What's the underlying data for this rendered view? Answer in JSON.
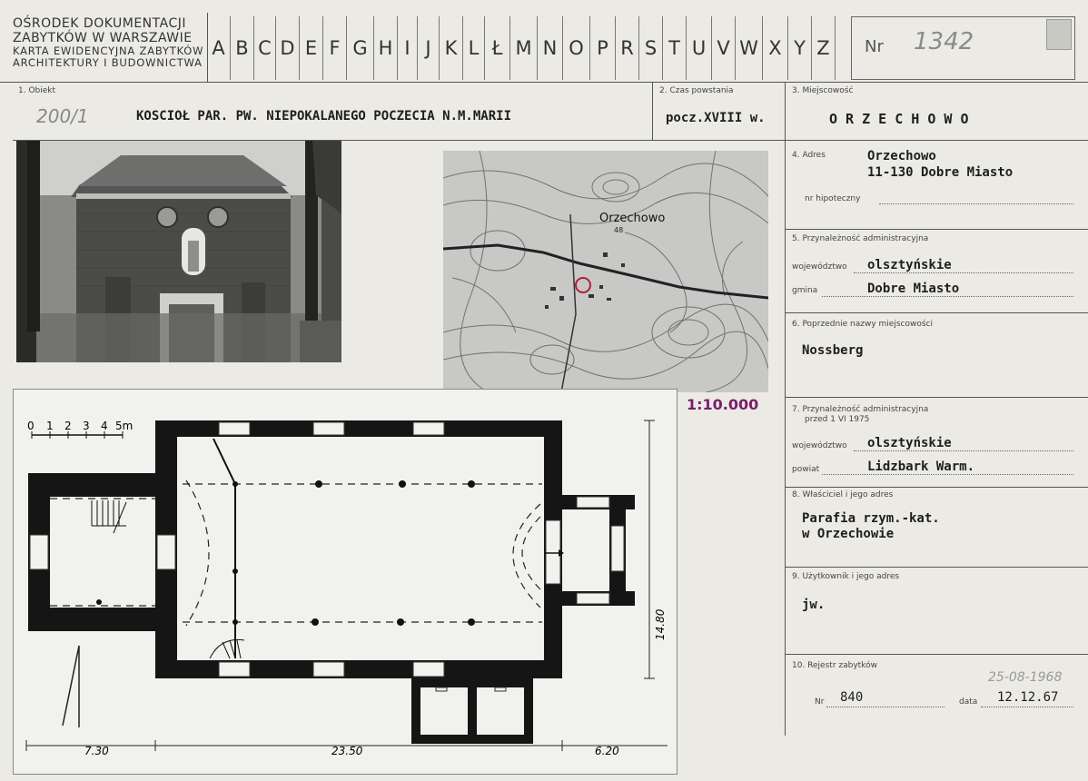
{
  "header": {
    "institution_line1": "OŚRODEK DOKUMENTACJI",
    "institution_line2": "ZABYTKÓW W WARSZAWIE",
    "institution_line3": "KARTA EWIDENCYJNA ZABYTKÓW",
    "institution_line4": "ARCHITEKTURY I BUDOWNICTWA",
    "letters": [
      "A",
      "B",
      "C",
      "D",
      "E",
      "F",
      "G",
      "H",
      "I",
      "J",
      "K",
      "L",
      "Ł",
      "M",
      "N",
      "O",
      "P",
      "R",
      "S",
      "T",
      "U",
      "V",
      "W",
      "X",
      "Y",
      "Z"
    ],
    "nr_label": "Nr",
    "nr_value": "1342"
  },
  "obiekt": {
    "label": "1. Obiekt",
    "handwritten": "200/1",
    "value": "KOSCIOŁ PAR. PW. NIEPOKALANEGO POCZECIA N.M.MARII"
  },
  "czas": {
    "label": "2. Czas powstania",
    "value": "pocz.XVIII w."
  },
  "miejscowosc": {
    "label": "3. Miejscowość",
    "value": "O R Z E C H O W O"
  },
  "adres": {
    "label": "4. Adres",
    "line1": "Orzechowo",
    "line2": "11-130 Dobre Miasto",
    "hipoteczny_label": "nr hipoteczny"
  },
  "przynaleznosc": {
    "label": "5. Przynależność administracyjna",
    "wojewodztwo_label": "województwo",
    "wojewodztwo": "olsztyńskie",
    "gmina_label": "gmina",
    "gmina": "Dobre Miasto"
  },
  "poprzednie": {
    "label": "6. Poprzednie nazwy miejscowości",
    "value": "Nossberg"
  },
  "przynaleznosc_1975": {
    "label_line1": "7. Przynależność administracyjna",
    "label_line2": "przed 1 VI 1975",
    "wojewodztwo_label": "województwo",
    "wojewodztwo": "olsztyńskie",
    "powiat_label": "powiat",
    "powiat": "Lidzbark Warm."
  },
  "wlasciciel": {
    "label": "8. Właściciel i jego adres",
    "line1": "Parafia rzym.-kat.",
    "line2": "w Orzechowie"
  },
  "uzytkownik": {
    "label": "9. Użytkownik i jego adres",
    "value": "jw."
  },
  "rejestr": {
    "label": "10. Rejestr zabytków",
    "handwritten_date": "25-08-1968",
    "nr_label": "Nr",
    "nr_value": "840",
    "data_label": "data",
    "data_value": "12.12.67"
  },
  "map": {
    "place_label": "Orzechowo",
    "scale": "1:10.000"
  },
  "plan": {
    "scale_ticks": [
      "0",
      "1",
      "2",
      "3",
      "4",
      "5m"
    ],
    "dim_bottom_left": "7.30",
    "dim_bottom_mid": "23.50",
    "dim_bottom_right": "6.20",
    "dim_right": "14.80"
  },
  "colors": {
    "paper": "#ebeae4",
    "ink": "#1e1e1e",
    "red_mark": "#b0203a",
    "purple_ink": "#7a1d6a"
  }
}
